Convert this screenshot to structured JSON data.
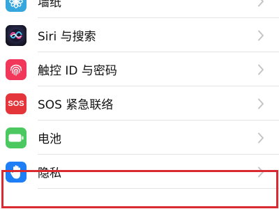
{
  "settings": {
    "items": [
      {
        "label": "墙纸",
        "icon": "wallpaper-flower-icon",
        "color": "#35a7dd"
      },
      {
        "label": "Siri 与搜索",
        "icon": "siri-icon",
        "color": "#1c1c2e"
      },
      {
        "label": "触控 ID 与密码",
        "icon": "fingerprint-icon",
        "color": "#f1385a"
      },
      {
        "label": "SOS 紧急联络",
        "icon": "sos-icon",
        "color": "#e4353a",
        "icon_text": "SOS"
      },
      {
        "label": "电池",
        "icon": "battery-icon",
        "color": "#4cc860"
      },
      {
        "label": "隐私",
        "icon": "privacy-hand-icon",
        "color": "#1e7ef5",
        "highlighted": true
      }
    ]
  },
  "colors": {
    "highlight_border": "#d92a32",
    "chevron": "#c4c4c7",
    "separator": "#e3e3e6"
  }
}
